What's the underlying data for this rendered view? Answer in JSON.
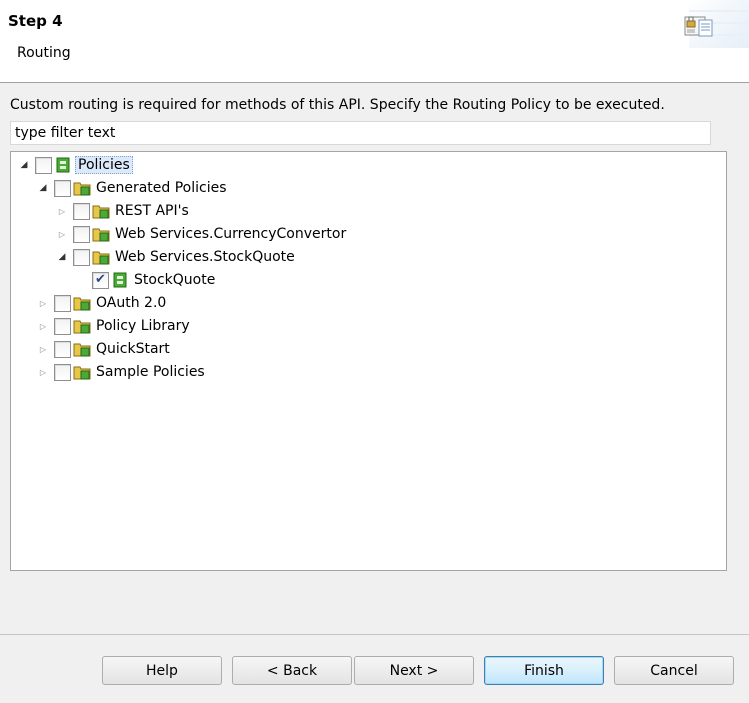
{
  "header": {
    "title": "Step 4",
    "subtitle": "Routing"
  },
  "description": "Custom routing is required for methods of this API. Specify the Routing Policy to be executed.",
  "filter": {
    "value": "type filter text"
  },
  "tree": {
    "root": {
      "label": "Policies",
      "expanded": true,
      "checked": false,
      "selected": true
    },
    "generated": {
      "label": "Generated Policies",
      "expanded": true,
      "checked": false
    },
    "rest": {
      "label": "REST API's",
      "expanded": false,
      "checked": false
    },
    "currency": {
      "label": "Web Services.CurrencyConvertor",
      "expanded": false,
      "checked": false
    },
    "stockquote_folder": {
      "label": "Web Services.StockQuote",
      "expanded": true,
      "checked": false
    },
    "stockquote_policy": {
      "label": "StockQuote",
      "checked": true
    },
    "oauth": {
      "label": "OAuth 2.0",
      "expanded": false,
      "checked": false
    },
    "library": {
      "label": "Policy Library",
      "expanded": false,
      "checked": false
    },
    "quickstart": {
      "label": "QuickStart",
      "expanded": false,
      "checked": false
    },
    "samples": {
      "label": "Sample Policies",
      "expanded": false,
      "checked": false
    }
  },
  "buttons": {
    "help": "Help",
    "back": "< Back",
    "next": "Next >",
    "finish": "Finish",
    "cancel": "Cancel"
  },
  "icons": {
    "folder": "folder-policy-icon",
    "policy": "policy-icon",
    "wizard": "wizard-banner-icon"
  },
  "colors": {
    "folder": "#e8c64a",
    "policy_green": "#3a9a2a",
    "selection": "#dbe9fb",
    "default_button_border": "#3c7fb1"
  }
}
